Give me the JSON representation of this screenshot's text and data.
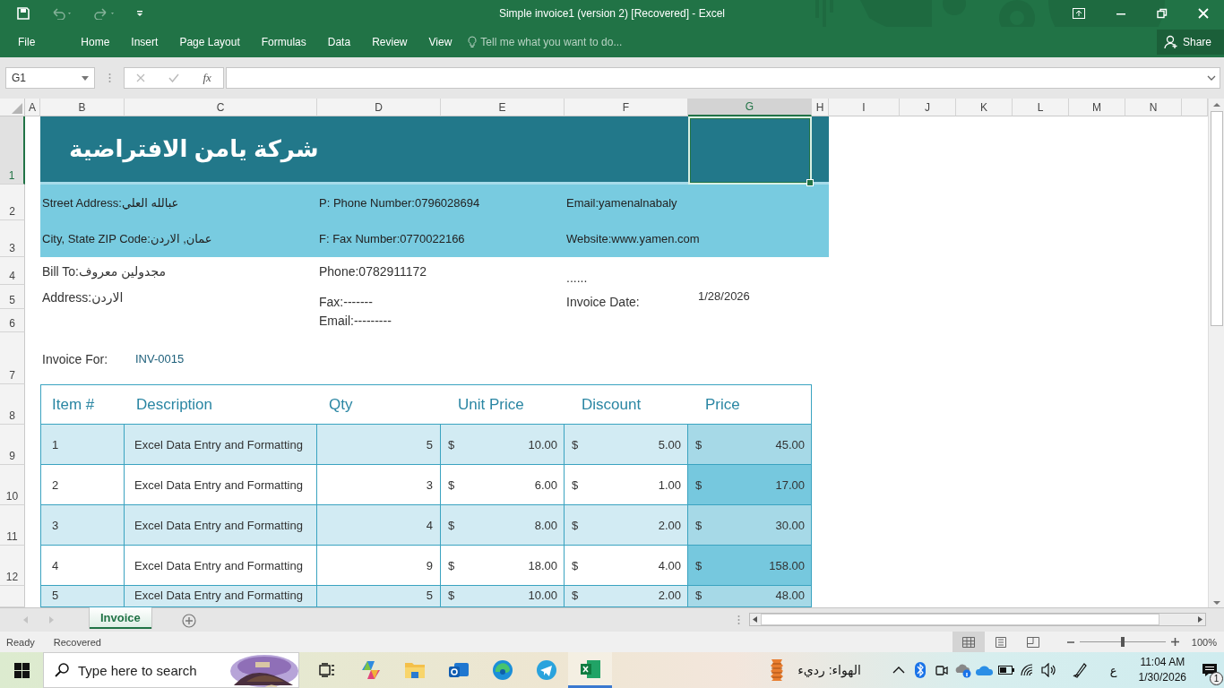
{
  "window": {
    "title": "Simple invoice1 (version 2) [Recovered] - Excel"
  },
  "ribbon": {
    "tabs": [
      {
        "label": "File"
      },
      {
        "label": "Home"
      },
      {
        "label": "Insert"
      },
      {
        "label": "Page Layout"
      },
      {
        "label": "Formulas"
      },
      {
        "label": "Data"
      },
      {
        "label": "Review"
      },
      {
        "label": "View"
      }
    ],
    "tell_me": {
      "placeholder": "Tell me what you want to do..."
    },
    "share": "Share"
  },
  "formula_bar": {
    "name_box": "G1",
    "function_label": "fx"
  },
  "sheet": {
    "columns": [
      {
        "label": "A",
        "selected": false
      },
      {
        "label": "B",
        "selected": false
      },
      {
        "label": "C",
        "selected": false
      },
      {
        "label": "D",
        "selected": false
      },
      {
        "label": "E",
        "selected": false
      },
      {
        "label": "F",
        "selected": false
      },
      {
        "label": "G",
        "selected": true
      },
      {
        "label": "H",
        "selected": false
      },
      {
        "label": "I",
        "selected": false
      },
      {
        "label": "J",
        "selected": false
      },
      {
        "label": "K",
        "selected": false
      },
      {
        "label": "L",
        "selected": false
      },
      {
        "label": "M",
        "selected": false
      },
      {
        "label": "N",
        "selected": false
      }
    ],
    "rows": [
      {
        "label": "1",
        "selected": true
      },
      {
        "label": "2",
        "selected": false
      },
      {
        "label": "3",
        "selected": false
      },
      {
        "label": "4",
        "selected": false
      },
      {
        "label": "5",
        "selected": false
      },
      {
        "label": "6",
        "selected": false
      },
      {
        "label": "7",
        "selected": false
      },
      {
        "label": "8",
        "selected": false
      },
      {
        "label": "9",
        "selected": false
      },
      {
        "label": "10",
        "selected": false
      },
      {
        "label": "11",
        "selected": false
      },
      {
        "label": "12",
        "selected": false
      }
    ]
  },
  "invoice": {
    "company": "شركة يامن الافتراضية",
    "contact_rows": [
      [
        "Street Address:عبالله العلي",
        "P: Phone Number:0796028694",
        "Email:yamenalnabaly"
      ],
      [
        "City, State ZIP Code:عمان, الاردن",
        "F: Fax Number:0770022166",
        "Website:www.yamen.com"
      ]
    ],
    "bill_to": "Bill To:مجدولين معروف",
    "address": "Address:الاردن",
    "phone": "Phone:0782911172",
    "fax": "Fax:-------",
    "email": "Email:---------",
    "dots": "......",
    "date_label": "Invoice Date:",
    "date": "1/28/2026",
    "invoice_for_label": "Invoice For:",
    "invoice_number": "INV-0015",
    "columns": [
      "Item #",
      "Description",
      "Qty",
      "Unit Price",
      "Discount",
      "Price"
    ],
    "items": [
      {
        "item": "1",
        "description": "Excel Data Entry and Formatting",
        "qty": "5",
        "unit_price": [
          "$",
          "10.00"
        ],
        "discount": [
          "$",
          "5.00"
        ],
        "price": [
          "$",
          "45.00"
        ],
        "banded": true,
        "highlighted": false
      },
      {
        "item": "2",
        "description": "Excel Data Entry and Formatting",
        "qty": "3",
        "unit_price": [
          "$",
          "6.00"
        ],
        "discount": [
          "$",
          "1.00"
        ],
        "price": [
          "$",
          "17.00"
        ],
        "banded": false,
        "highlighted": true
      },
      {
        "item": "3",
        "description": "Excel Data Entry and Formatting",
        "qty": "4",
        "unit_price": [
          "$",
          "8.00"
        ],
        "discount": [
          "$",
          "2.00"
        ],
        "price": [
          "$",
          "30.00"
        ],
        "banded": true,
        "highlighted": false
      },
      {
        "item": "4",
        "description": "Excel Data Entry and Formatting",
        "qty": "9",
        "unit_price": [
          "$",
          "18.00"
        ],
        "discount": [
          "$",
          "4.00"
        ],
        "price": [
          "$",
          "158.00"
        ],
        "banded": false,
        "highlighted": true
      },
      {
        "item": "5",
        "description": "Excel Data Entry and Formatting",
        "qty": "5",
        "unit_price": [
          "$",
          "10.00"
        ],
        "discount": [
          "$",
          "2.00"
        ],
        "price": [
          "$",
          "48.00"
        ],
        "banded": true,
        "highlighted": false
      }
    ]
  },
  "sheet_tabs": [
    {
      "label": "Invoice",
      "selected": true
    }
  ],
  "status_bar": {
    "mode": "Ready",
    "state": "Recovered",
    "zoom": {
      "level": 0.5,
      "reading": "100%"
    }
  },
  "taskbar": {
    "search": {
      "placeholder": "Type here to search"
    },
    "weather": "الهواء: رديء",
    "language": "ع",
    "time": "11:04 AM",
    "date": "1/30/2026",
    "notifications": "1"
  }
}
